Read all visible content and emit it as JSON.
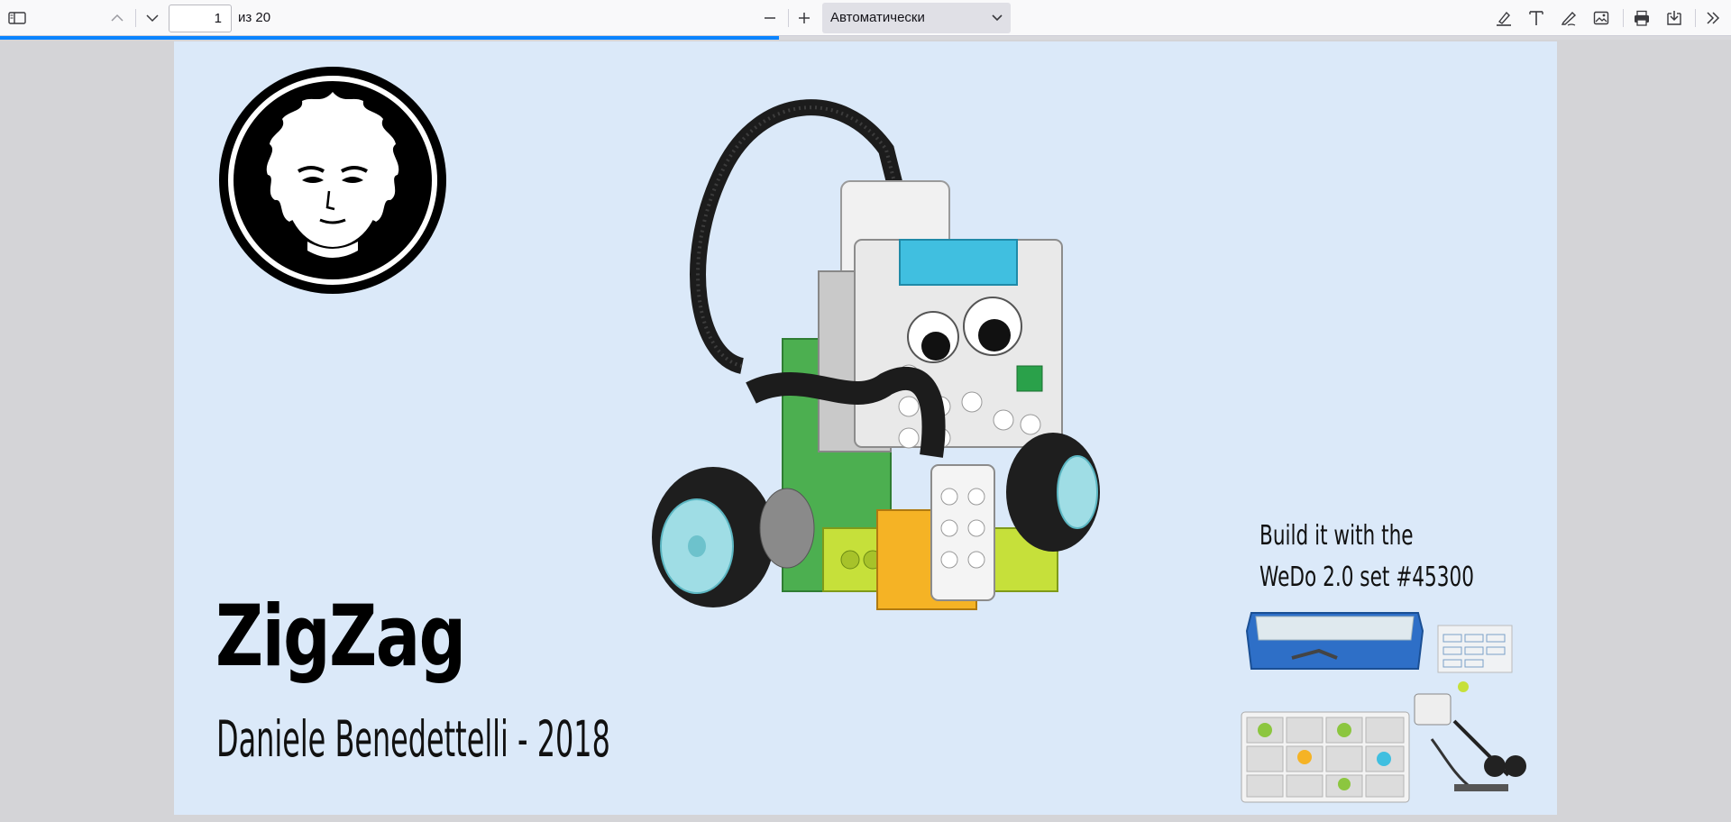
{
  "toolbar": {
    "page_number": "1",
    "page_count": "из 20",
    "zoom_value": "Автоматически",
    "progress_fraction": 0.45
  },
  "document": {
    "title": "ZigZag",
    "subtitle": "Daniele Benedettelli - 2018",
    "build_line1": "Build it with the",
    "build_line2": "WeDo 2.0 set #45300"
  },
  "colors": {
    "page_bg": "#dbe9f9",
    "accent": "#0a84ff"
  }
}
